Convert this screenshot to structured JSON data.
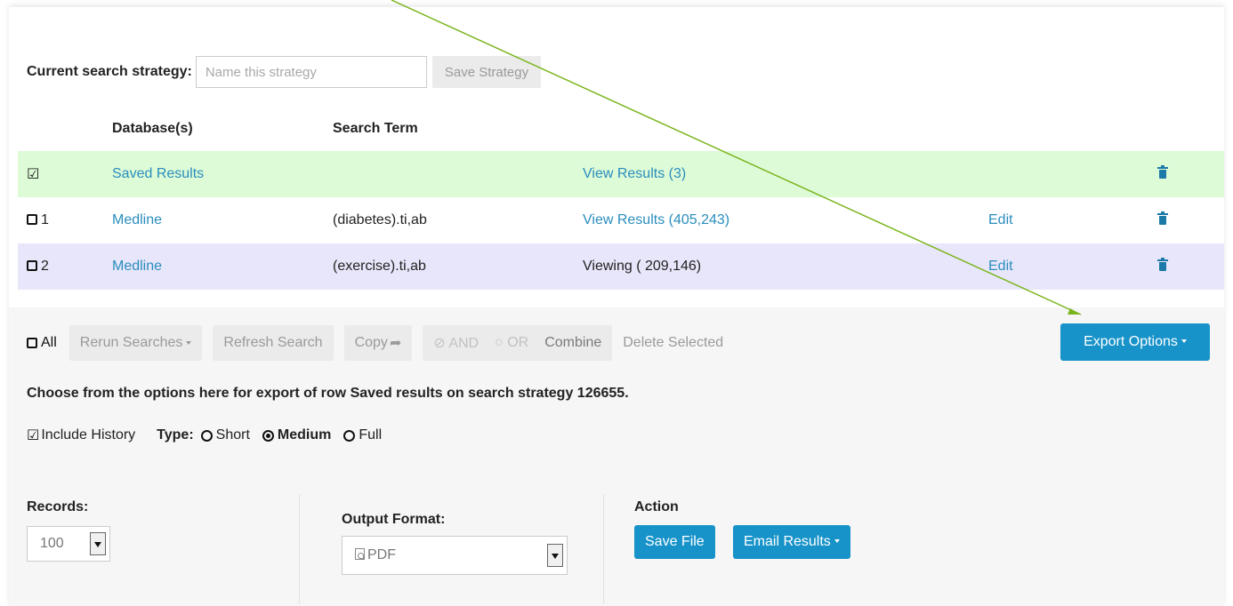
{
  "strategy": {
    "label": "Current search strategy:",
    "placeholder": "Name this strategy",
    "save_label": "Save Strategy"
  },
  "table": {
    "headers": [
      "Database(s)",
      "Search Term"
    ],
    "rows": [
      {
        "num": "",
        "checked": true,
        "database": "Saved Results",
        "term": "",
        "results": "View Results (3)",
        "edit": "",
        "bg": "#ddfbd7"
      },
      {
        "num": "1",
        "checked": false,
        "database": "Medline",
        "term": "(diabetes).ti,ab",
        "results": "View Results (405,243)",
        "edit": "Edit",
        "bg": "#ffffff"
      },
      {
        "num": "2",
        "checked": false,
        "database": "Medline",
        "term": "(exercise).ti,ab",
        "results": "Viewing ( 209,146)",
        "edit": "Edit",
        "bg": "#e8e6fa"
      }
    ]
  },
  "toolbar": {
    "all_label": "All",
    "rerun_label": "Rerun Searches",
    "refresh_label": "Refresh Search",
    "copy_label": "Copy",
    "and_label": "AND",
    "or_label": "OR",
    "combine_label": "Combine",
    "delete_label": "Delete Selected",
    "export_label": "Export Options"
  },
  "export": {
    "message": "Choose from the options here for export of row Saved results on search strategy 126655.",
    "include_history_label": "Include History",
    "type_label": "Type:",
    "types": [
      "Short",
      "Medium",
      "Full"
    ],
    "selected_type": "Medium",
    "records_label": "Records:",
    "records_value": "100",
    "output_label": "Output Format:",
    "output_value": "PDF",
    "action_label": "Action",
    "save_file_label": "Save File",
    "email_label": "Email Results"
  },
  "colors": {
    "accent": "#1793c9",
    "link": "#2a8dbd",
    "row_saved": "#ddfbd7",
    "row_viewing": "#e8e6fa",
    "annotation_arrow": "#7ab51d"
  },
  "icons": [
    "checked-checkbox-icon",
    "checkbox-icon",
    "trash-icon",
    "share-arrow-icon",
    "check-circle-icon",
    "radio-icon",
    "pdf-file-icon",
    "select-arrow-icon",
    "caret-down-icon"
  ]
}
